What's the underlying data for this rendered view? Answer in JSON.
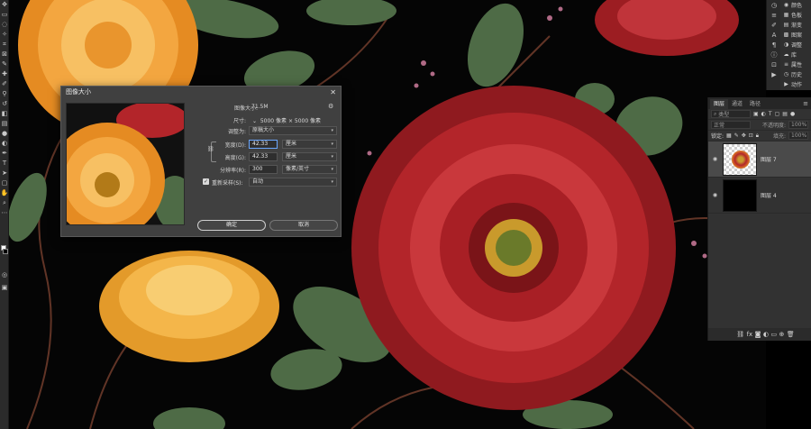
{
  "dialog": {
    "title": "图像大小",
    "close_glyph": "✕",
    "image_size_label": "图像大小:",
    "image_size_value": "71.5M",
    "dimensions_label": "尺寸:",
    "dimensions_value": "5000 像素 × 5000 像素",
    "fit_to_label": "调整为:",
    "fit_to_value": "原稿大小",
    "width_label": "宽度(D):",
    "width_value": "42.33",
    "width_unit": "厘米",
    "height_label": "高度(G):",
    "height_value": "42.33",
    "height_unit": "厘米",
    "resolution_label": "分辨率(R):",
    "resolution_value": "300",
    "resolution_unit": "像素/英寸",
    "resample_label": "重新采样(S):",
    "resample_value": "自动",
    "ok_label": "确定",
    "cancel_label": "取消"
  },
  "layers_panel": {
    "tabs": [
      "图层",
      "通道",
      "路径"
    ],
    "search_placeholder": "类型",
    "blend_mode": "正常",
    "opacity_label": "不透明度:",
    "opacity_value": "100%",
    "lock_label": "锁定:",
    "fill_label": "填充:",
    "fill_value": "100%",
    "layers": [
      {
        "name": "图层 7",
        "selected": true
      },
      {
        "name": "图层 4",
        "selected": false
      }
    ],
    "footer_icons": [
      "link-icon",
      "fx-icon",
      "mask-icon",
      "adjustment-icon",
      "folder-icon",
      "new-layer-icon",
      "trash-icon"
    ]
  },
  "dock": {
    "items": [
      "颜色",
      "色板",
      "渐变",
      "图案",
      "调整",
      "库",
      "属性",
      "历史",
      "动作"
    ]
  },
  "colors": {
    "accent": "#6aa7ff",
    "panel_bg": "#323232",
    "dialog_bg": "#404040",
    "red_flower": "#b3252a",
    "orange_flower": "#f0a83a"
  }
}
